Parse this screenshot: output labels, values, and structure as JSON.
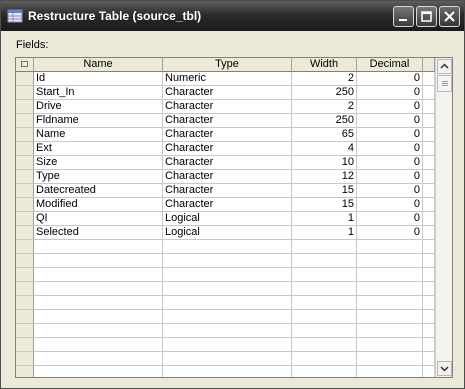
{
  "window": {
    "title": "Restructure Table (source_tbl)"
  },
  "fields_label": "Fields:",
  "table": {
    "headers": [
      "Name",
      "Type",
      "Width",
      "Decimal"
    ],
    "rows": [
      [
        "Id",
        "Numeric",
        "2",
        "0"
      ],
      [
        "Start_In",
        "Character",
        "250",
        "0"
      ],
      [
        "Drive",
        "Character",
        "2",
        "0"
      ],
      [
        "Fldname",
        "Character",
        "250",
        "0"
      ],
      [
        "Name",
        "Character",
        "65",
        "0"
      ],
      [
        "Ext",
        "Character",
        "4",
        "0"
      ],
      [
        "Size",
        "Character",
        "10",
        "0"
      ],
      [
        "Type",
        "Character",
        "12",
        "0"
      ],
      [
        "Datecreated",
        "Character",
        "15",
        "0"
      ],
      [
        "Modified",
        "Character",
        "15",
        "0"
      ],
      [
        "QI",
        "Logical",
        "1",
        "0"
      ],
      [
        "Selected",
        "Logical",
        "1",
        "0"
      ]
    ]
  },
  "colors": {
    "titlebar": "#2c2c2c",
    "chrome": "#ece9d8",
    "grid_lines": "#c8c8c8"
  },
  "icons": [
    "app-table-icon",
    "minimize-icon",
    "maximize-icon",
    "close-icon",
    "scroll-up-arrow-icon",
    "scroll-down-arrow-icon"
  ]
}
